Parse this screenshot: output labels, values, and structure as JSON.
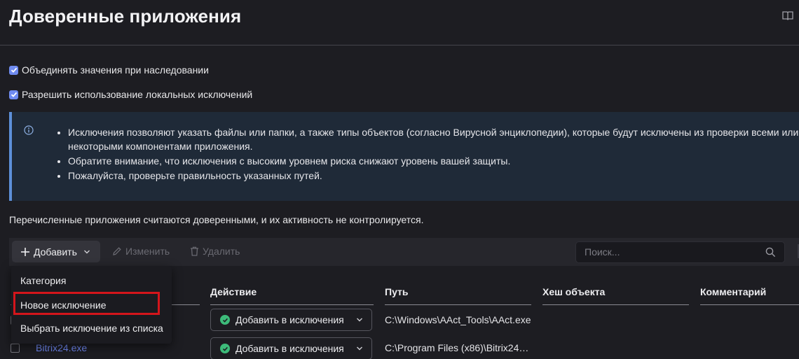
{
  "page": {
    "title": "Доверенные приложения"
  },
  "options": {
    "merge_values": "Объединять значения при наследовании",
    "allow_local": "Разрешить использование локальных исключений"
  },
  "info": {
    "items": [
      "Исключения позволяют указать файлы или папки, а также типы объектов (согласно Вирусной энциклопедии), которые будут исключены из проверки всеми или некоторыми компонентами приложения.",
      "Обратите внимание, что исключения с высоким уровнем риска снижают уровень вашей защиты.",
      "Пожалуйста, проверьте правильность указанных путей."
    ]
  },
  "trusted_text": "Перечисленные приложения считаются доверенными, и их активность не контролируется.",
  "toolbar": {
    "add_label": "Добавить",
    "edit_label": "Изменить",
    "delete_label": "Удалить",
    "search_placeholder": "Поиск..."
  },
  "dropdown": {
    "items": [
      "Категория",
      "Новое исключение",
      "Выбрать исключение из списка"
    ]
  },
  "table": {
    "columns": [
      "Действие",
      "Путь",
      "Хеш объекта",
      "Комментарий"
    ],
    "rows": [
      {
        "app": "",
        "action": "Добавить в исключения",
        "path": "C:\\Windows\\AAct_Tools\\AAct.exe"
      },
      {
        "app": "Bitrix24.exe",
        "action": "Добавить в исключения",
        "path": "C:\\Program Files (x86)\\Bitrix24…"
      }
    ]
  },
  "colors": {
    "accent": "#6f8bf0",
    "success": "#3dbb7a",
    "highlight": "#d4151b",
    "link": "#6e86ee"
  }
}
